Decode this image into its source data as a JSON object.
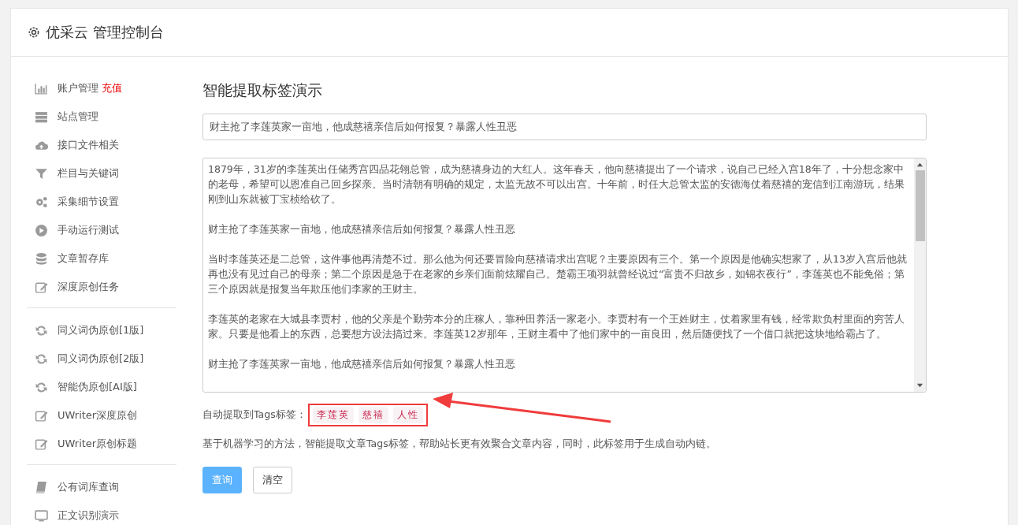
{
  "header": {
    "title": "优采云 管理控制台"
  },
  "sidebar": {
    "groups": [
      {
        "items": [
          {
            "kind": "bar-chart",
            "label": "账户管理",
            "link": "充值"
          },
          {
            "kind": "server",
            "label": "站点管理"
          },
          {
            "kind": "cloud",
            "label": "接口文件相关"
          },
          {
            "kind": "filter",
            "label": "栏目与关键词"
          },
          {
            "kind": "gears",
            "label": "采集细节设置"
          },
          {
            "kind": "play",
            "label": "手动运行测试"
          },
          {
            "kind": "database",
            "label": "文章暂存库"
          },
          {
            "kind": "edit",
            "label": "深度原创任务"
          }
        ]
      },
      {
        "items": [
          {
            "kind": "refresh",
            "label": "同义词伪原创[1版]"
          },
          {
            "kind": "refresh",
            "label": "同义词伪原创[2版]"
          },
          {
            "kind": "refresh",
            "label": "智能伪原创[AI版]"
          },
          {
            "kind": "edit",
            "label": "UWriter深度原创"
          },
          {
            "kind": "edit",
            "label": "UWriter原创标题"
          }
        ]
      },
      {
        "items": [
          {
            "kind": "book",
            "label": "公有词库查询"
          },
          {
            "kind": "monitor",
            "label": "正文识别演示"
          }
        ]
      }
    ]
  },
  "main": {
    "heading": "智能提取标签演示",
    "title_field": {
      "value": "财主抢了李莲英家一亩地，他成慈禧亲信后如何报复？暴露人性丑恶"
    },
    "content_field": {
      "paragraphs": [
        "1879年，31岁的李莲英出任储秀宫四品花翎总管，成为慈禧身边的大红人。这年春天，他向慈禧提出了一个请求，说自己已经入宫18年了，十分想念家中的老母，希望可以恩准自己回乡探亲。当时清朝有明确的规定，太监无故不可以出宫。十年前，时任大总管太监的安德海仗着慈禧的宠信到江南游玩，结果刚到山东就被丁宝桢给砍了。",
        "财主抢了李莲英家一亩地，他成慈禧亲信后如何报复？暴露人性丑恶",
        "当时李莲英还是二总管，这件事他再清楚不过。那么他为何还要冒险向慈禧请求出宫呢？主要原因有三个。第一个原因是他确实想家了，从13岁入宫后他就再也没有见过自己的母亲；第二个原因是急于在老家的乡亲们面前炫耀自己。楚霸王项羽就曾经说过“富贵不归故乡，如锦衣夜行”，李莲英也不能免俗；第三个原因就是报复当年欺压他们李家的王财主。",
        "李莲英的老家在大城县李贾村，他的父亲是个勤劳本分的庄稼人，靠种田养活一家老小。李贾村有一个王姓财主，仗着家里有钱，经常欺负村里面的穷苦人家。只要是他看上的东西，总要想方设法搞过来。李莲英12岁那年，王财主看中了他们家中的一亩良田，然后随便找了一个借口就把这块地给霸占了。",
        "财主抢了李莲英家一亩地，他成慈禧亲信后如何报复？暴露人性丑恶"
      ]
    },
    "tags_label": "自动提取到Tags标签：",
    "tags": [
      "李莲英",
      "慈禧",
      "人性"
    ],
    "description": "基于机器学习的方法，智能提取文章Tags标签，帮助站长更有效聚合文章内容，同时，此标签用于生成自动内链。",
    "buttons": [
      {
        "kind": "primary",
        "label": "查询"
      },
      {
        "kind": "default",
        "label": "清空"
      }
    ]
  }
}
